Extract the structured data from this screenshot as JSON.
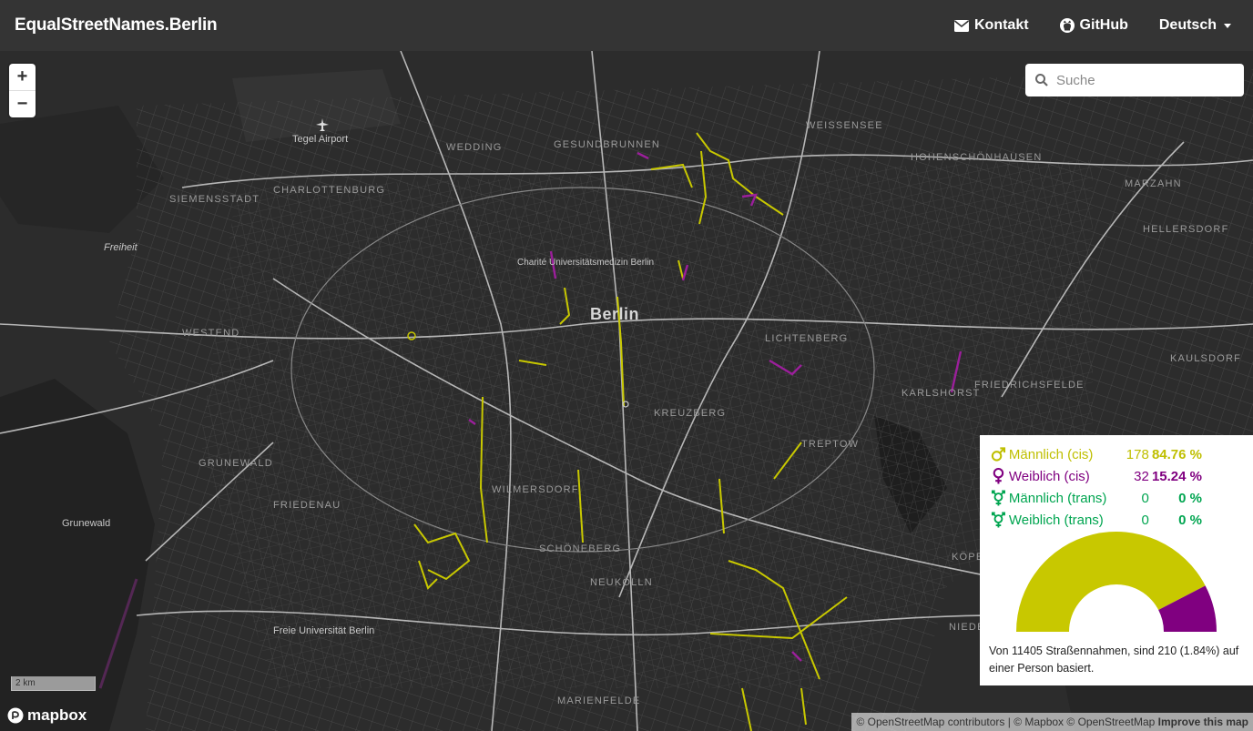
{
  "navbar": {
    "brand": "EqualStreetNames.Berlin",
    "contact_label": "Kontakt",
    "github_label": "GitHub",
    "language_label": "Deutsch"
  },
  "map": {
    "search_placeholder": "Suche",
    "zoom_in": "+",
    "zoom_out": "−",
    "scale_label": "2 km",
    "logo_text": "mapbox",
    "attribution": {
      "osm": "© OpenStreetMap contributors",
      "sep": " | ",
      "mapbox": "© Mapbox",
      "osm2": "© OpenStreetMap",
      "improve": "Improve this map"
    },
    "labels": {
      "tegel": "Tegel Airport",
      "wedding": "WEDDING",
      "gesundbrunnen": "GESUNDBRUNNEN",
      "weissensee": "WEISSENSEE",
      "hohenschoenhausen": "HOHENSCHÖNHAUSEN",
      "siemensstadt": "SIEMENSSTADT",
      "charlottenburg": "CHARLOTTENBURG",
      "freiheit": "Freiheit",
      "marzahn": "MARZAHN",
      "hellersdorf": "HELLERSDORF",
      "charite": "Charité Universitätsmedizin Berlin",
      "berlin": "Berlin",
      "westend": "WESTEND",
      "lichtenberg": "LICHTENBERG",
      "karlshorst": "KARLSHORST",
      "friedrichsfelde": "FRIEDRICHSFELDE",
      "kreuzberg": "KREUZBERG",
      "grunewald_upper": "GRUNEWALD",
      "grunewald": "Grunewald",
      "treptow": "TREPTOW",
      "schoeneberg": "SCHÖNEBERG",
      "wilmersdorf": "WILMERSDORF",
      "friedenau": "FRIEDENAU",
      "neukoelln": "NEUKÖLLN",
      "fu": "Freie Universität Berlin",
      "marienfelde": "MARIENFELDE",
      "koepenick": "KÖPENICK",
      "niederschoeneweide": "NIEDERSCHÖNEWEIDE",
      "kaulsdorf": "KAULSDORF"
    }
  },
  "stats": {
    "rows": [
      {
        "label": "Männlich (cis)",
        "count": "178",
        "percent": "84.76 %",
        "color": "#bfbf00",
        "icon": "male-icon"
      },
      {
        "label": "Weiblich (cis)",
        "count": "32",
        "percent": "15.24 %",
        "color": "#800080",
        "icon": "female-icon"
      },
      {
        "label": "Männlich (trans)",
        "count": "0",
        "percent": "0 %",
        "color": "#00a550",
        "icon": "transgender-icon"
      },
      {
        "label": "Weiblich (trans)",
        "count": "0",
        "percent": "0 %",
        "color": "#00a550",
        "icon": "transgender-icon"
      }
    ],
    "gauge": {
      "male_fraction": 0.8476,
      "female_fraction": 0.1524,
      "male_color": "#c8c800",
      "female_color": "#800080"
    },
    "summary": "Von 11405 Straßennahmen, sind 210 (1.84%) auf einer Person basiert."
  }
}
